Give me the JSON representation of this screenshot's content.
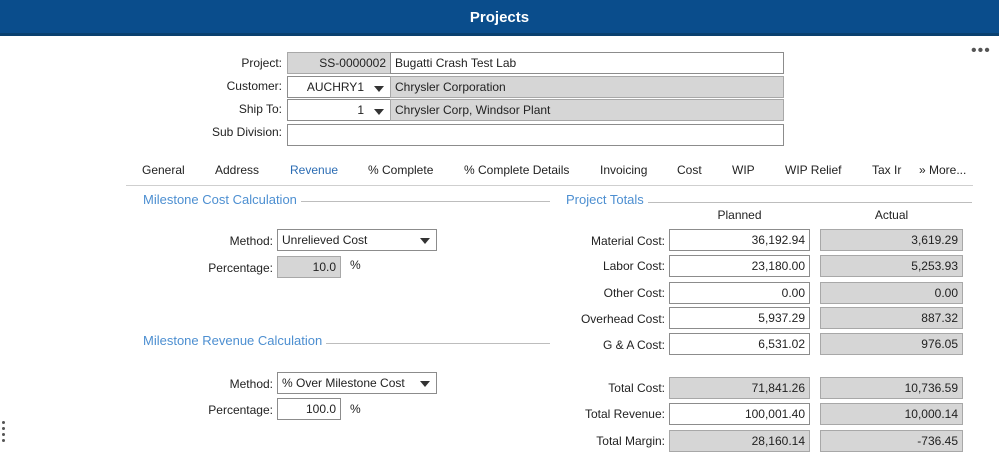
{
  "header": {
    "title": "Projects"
  },
  "form": {
    "project_label": "Project:",
    "project_id": "SS-0000002",
    "project_name": "Bugatti Crash Test Lab",
    "customer_label": "Customer:",
    "customer_id": "AUCHRY1",
    "customer_name": "Chrysler Corporation",
    "shipto_label": "Ship To:",
    "shipto_id": "1",
    "shipto_name": "Chrysler Corp, Windsor Plant",
    "subdivision_label": "Sub Division:",
    "subdivision_value": ""
  },
  "tabs": [
    "General",
    "Address",
    "Revenue",
    "% Complete",
    "% Complete Details",
    "Invoicing",
    "Cost",
    "WIP",
    "WIP Relief",
    "Tax Ir",
    "» More..."
  ],
  "active_tab": "Revenue",
  "milestone_cost": {
    "title": "Milestone Cost Calculation",
    "method_label": "Method:",
    "method_value": "Unrelieved Cost",
    "percentage_label": "Percentage:",
    "percentage_value": "10.0",
    "percent_sign": "%"
  },
  "milestone_revenue": {
    "title": "Milestone Revenue Calculation",
    "method_label": "Method:",
    "method_value": "% Over Milestone Cost",
    "percentage_label": "Percentage:",
    "percentage_value": "100.0",
    "percent_sign": "%"
  },
  "totals": {
    "title": "Project Totals",
    "planned_header": "Planned",
    "actual_header": "Actual",
    "rows": [
      {
        "label": "Material Cost:",
        "planned": "36,192.94",
        "actual": "3,619.29"
      },
      {
        "label": "Labor Cost:",
        "planned": "23,180.00",
        "actual": "5,253.93"
      },
      {
        "label": "Other Cost:",
        "planned": "0.00",
        "actual": "0.00"
      },
      {
        "label": "Overhead Cost:",
        "planned": "5,937.29",
        "actual": "887.32"
      },
      {
        "label": "G & A Cost:",
        "planned": "6,531.02",
        "actual": "976.05"
      },
      {
        "label": "Total Cost:",
        "planned": "71,841.26",
        "actual": "10,736.59"
      },
      {
        "label": "Total Revenue:",
        "planned": "100,001.40",
        "actual": "10,000.14"
      },
      {
        "label": "Total Margin:",
        "planned": "28,160.14",
        "actual": "-736.45"
      }
    ]
  },
  "icons": {
    "more_menu": "more-horizontal-icon",
    "side_handle": "more-vertical-icon",
    "dropdown": "caret-down-icon"
  }
}
